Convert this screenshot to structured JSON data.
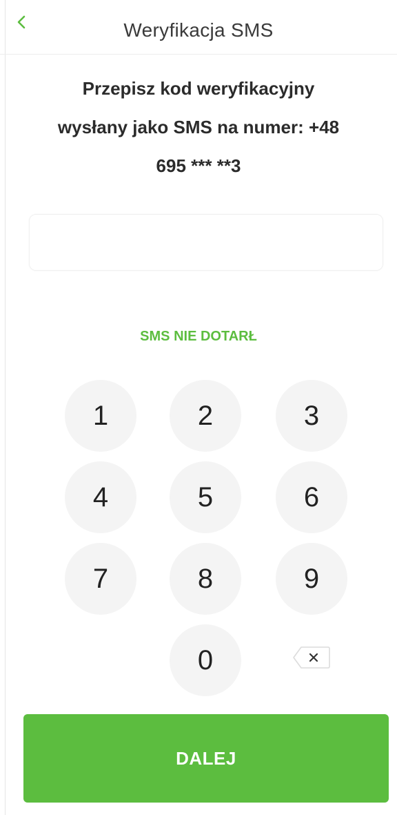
{
  "header": {
    "title": "Weryfikacja SMS",
    "back_icon": "chevron-left-icon"
  },
  "instruction": {
    "line1": "Przepisz kod weryfikacyjny",
    "line2": "wysłany jako SMS na numer: +48",
    "line3": "695 *** **3"
  },
  "code_input": {
    "value": "",
    "placeholder": ""
  },
  "sms_not_received_label": "SMS NIE DOTARŁ",
  "keypad": {
    "keys": [
      "1",
      "2",
      "3",
      "4",
      "5",
      "6",
      "7",
      "8",
      "9",
      "0"
    ],
    "backspace_icon": "backspace-icon"
  },
  "submit_label": "DALEJ",
  "colors": {
    "accent": "#5cbd3f",
    "key_background": "#f4f4f4",
    "text": "#2b2b2b"
  }
}
